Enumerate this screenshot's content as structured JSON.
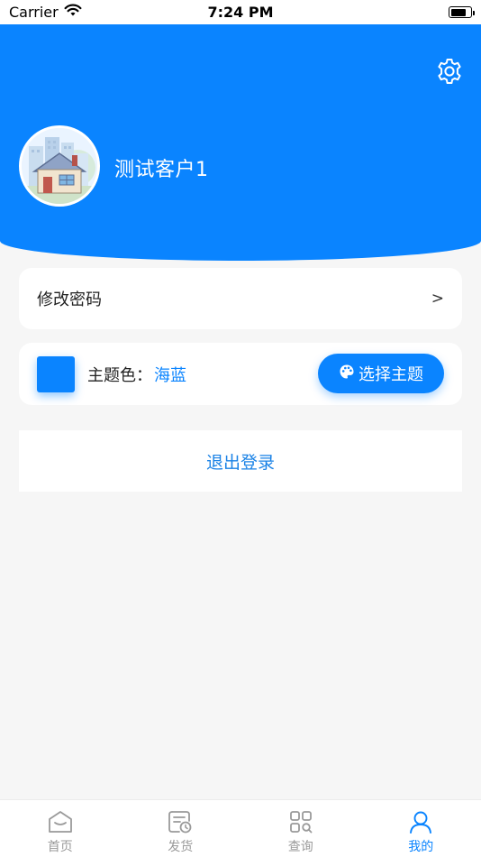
{
  "status_bar": {
    "carrier": "Carrier",
    "time": "7:24 PM"
  },
  "header": {
    "username": "测试客户1",
    "settings_icon": "gear-icon",
    "background_color": "#0a84ff"
  },
  "menu": {
    "change_password": {
      "label": "修改密码",
      "chevron": ">"
    },
    "theme": {
      "label": "主题色：",
      "value": "海蓝",
      "swatch_color": "#0a84ff",
      "button_label": "选择主题",
      "button_icon": "palette-icon"
    },
    "logout": {
      "label": "退出登录"
    }
  },
  "tab_bar": {
    "tabs": [
      {
        "label": "首页",
        "icon": "home-icon",
        "active": false
      },
      {
        "label": "发货",
        "icon": "shipment-icon",
        "active": false
      },
      {
        "label": "查询",
        "icon": "query-icon",
        "active": false
      },
      {
        "label": "我的",
        "icon": "user-icon",
        "active": true
      }
    ]
  },
  "colors": {
    "accent": "#0a84ff",
    "background": "#f6f6f6",
    "tab_inactive": "#9a9a9a"
  }
}
